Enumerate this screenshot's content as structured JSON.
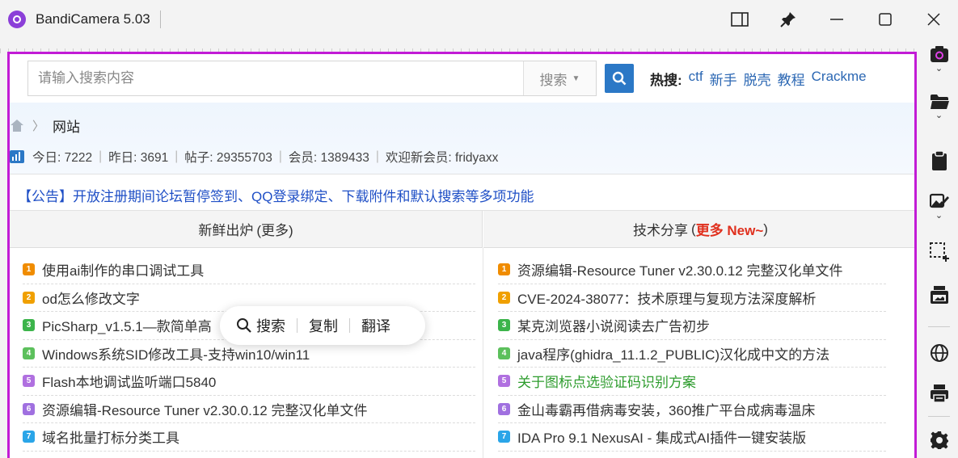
{
  "window": {
    "title": "BandiCamera 5.03",
    "controls": [
      "panel-toggle",
      "pin",
      "minimize",
      "maximize",
      "close"
    ]
  },
  "search": {
    "placeholder": "请输入搜索内容",
    "type_label": "搜索",
    "hot_label": "热搜:",
    "hot_links": [
      "ctf",
      "新手",
      "脱壳",
      "教程",
      "Crackme"
    ]
  },
  "breadcrumb": {
    "current": "网站"
  },
  "stats": {
    "today": "今日: 7222",
    "yesterday": "昨日: 3691",
    "posts": "帖子: 29355703",
    "members": "会员: 1389433",
    "welcome": "欢迎新会员: fridyaxx"
  },
  "notice": "【公告】开放注册期间论坛暂停签到、QQ登录绑定、下载附件和默认搜索等多项功能",
  "left_column": {
    "title": "新鲜出炉",
    "more": "(更多)",
    "items": [
      {
        "rank": "1",
        "text": "使用ai制作的串口调试工具"
      },
      {
        "rank": "2",
        "text": "od怎么修改文字"
      },
      {
        "rank": "3",
        "text": "PicSharp_v1.5.1—款简单高"
      },
      {
        "rank": "4",
        "text": "Windows系统SID修改工具-支持win10/win11"
      },
      {
        "rank": "5",
        "text": "Flash本地调试监听端口5840"
      },
      {
        "rank": "6",
        "text": "资源编辑-Resource Tuner v2.30.0.12 完整汉化单文件"
      },
      {
        "rank": "7",
        "text": "域名批量打标分类工具"
      }
    ]
  },
  "right_column": {
    "title": "技术分享",
    "more_prefix": "(",
    "more": "更多 New~",
    "more_suffix": ")",
    "items": [
      {
        "rank": "1",
        "text": "资源编辑-Resource Tuner v2.30.0.12 完整汉化单文件"
      },
      {
        "rank": "2",
        "text": "CVE-2024-38077：技术原理与复现方法深度解析"
      },
      {
        "rank": "3",
        "text": "某克浏览器小说阅读去广告初步"
      },
      {
        "rank": "4",
        "text": "java程序(ghidra_11.1.2_PUBLIC)汉化成中文的方法"
      },
      {
        "rank": "5",
        "text": "关于图标点选验证码识别方案",
        "highlight": true
      },
      {
        "rank": "6",
        "text": "金山毒霸再借病毒安装，360推广平台成病毒温床"
      },
      {
        "rank": "7",
        "text": "IDA Pro 9.1 NexusAI - 集成式AI插件一键安装版"
      }
    ]
  },
  "popup": {
    "search": "搜索",
    "copy": "复制",
    "translate": "翻译"
  },
  "colors": {
    "frame": "#c21bd6",
    "accent": "#2b78c6",
    "badge_1": "#f08c00",
    "badge_2": "#f0a000",
    "badge_3": "#3cb44b",
    "badge_4": "#5cc05c",
    "badge_5": "#b070e0",
    "badge_6": "#a070e0",
    "badge_7": "#2aa5e8"
  },
  "toolbar_icons": [
    "camera-icon",
    "folder-icon",
    "clipboard-icon",
    "edit-image-icon",
    "region-select-icon",
    "print-screen-icon",
    "globe-icon",
    "printer-icon",
    "settings-icon"
  ]
}
